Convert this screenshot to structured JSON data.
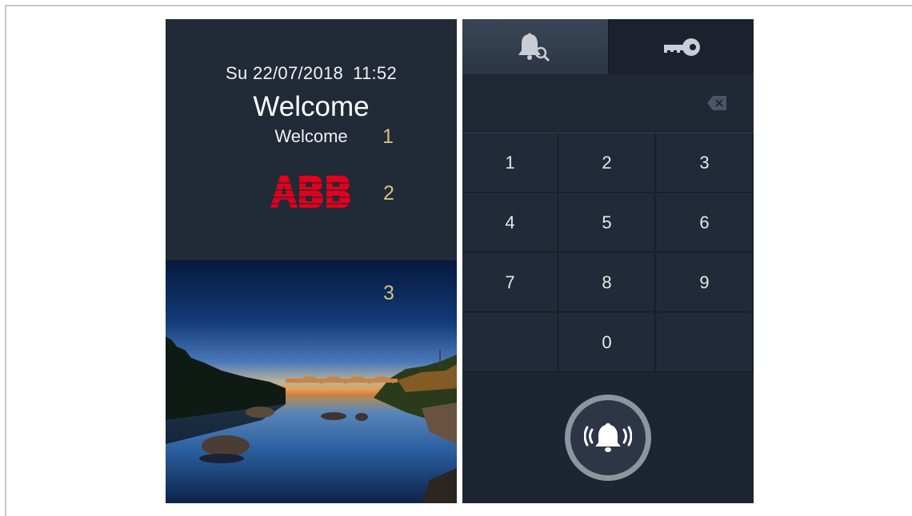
{
  "left_panel": {
    "day": "Su",
    "date": "22/07/2018",
    "time": "11:52",
    "welcome_title": "Welcome",
    "welcome_subtitle": "Welcome",
    "logo_text": "ABB",
    "markers": [
      "1",
      "2",
      "3"
    ]
  },
  "right_panel": {
    "tabs": [
      {
        "icon": "bell-search-icon",
        "active": true
      },
      {
        "icon": "key-icon",
        "active": false
      }
    ],
    "display_value": "",
    "keys": [
      "1",
      "2",
      "3",
      "4",
      "5",
      "6",
      "7",
      "8",
      "9",
      "",
      "0",
      ""
    ],
    "call_icon": "ringing-bell-icon"
  },
  "colors": {
    "panel_bg": "#212a37",
    "marker": "#d7c07a",
    "logo_red": "#e2001a"
  }
}
